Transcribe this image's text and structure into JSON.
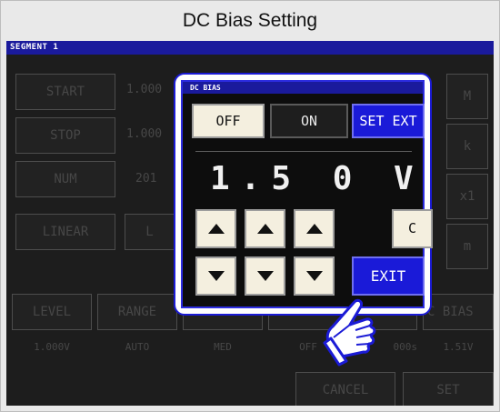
{
  "header": {
    "title": "DC Bias Setting"
  },
  "segment_bar": {
    "label": "SEGMENT 1"
  },
  "background": {
    "start_label": "START",
    "start_value": "1.000",
    "stop_label": "STOP",
    "stop_value": "1.000",
    "num_label": "NUM",
    "num_value": "201",
    "linear_label": "LINEAR",
    "log_label": "L",
    "unit_m": "M",
    "unit_k": "k",
    "unit_x1": "x1",
    "unit_mili": "m",
    "level_label": "LEVEL",
    "level_value": "1.000V",
    "range_label": "RANGE",
    "range_value": "AUTO",
    "speed_value": "MED",
    "avg_value": "OFF",
    "delay_value": "000s",
    "dcbias_label": "C BIAS",
    "dcbias_value": "1.51V",
    "cancel_label": "CANCEL",
    "set_label": "SET"
  },
  "dialog": {
    "title": "DC BIAS",
    "off_label": "OFF",
    "on_label": "ON",
    "set_ext_label": "SET EXT",
    "value_display": "1.5 0 V",
    "clear_label": "C",
    "exit_label": "EXIT"
  },
  "colors": {
    "accent_blue": "#1a1ad8",
    "dialog_border": "#1b1bd6",
    "button_cream": "#f4efdf"
  },
  "icons": {
    "pointer": "pointing-hand-icon"
  }
}
